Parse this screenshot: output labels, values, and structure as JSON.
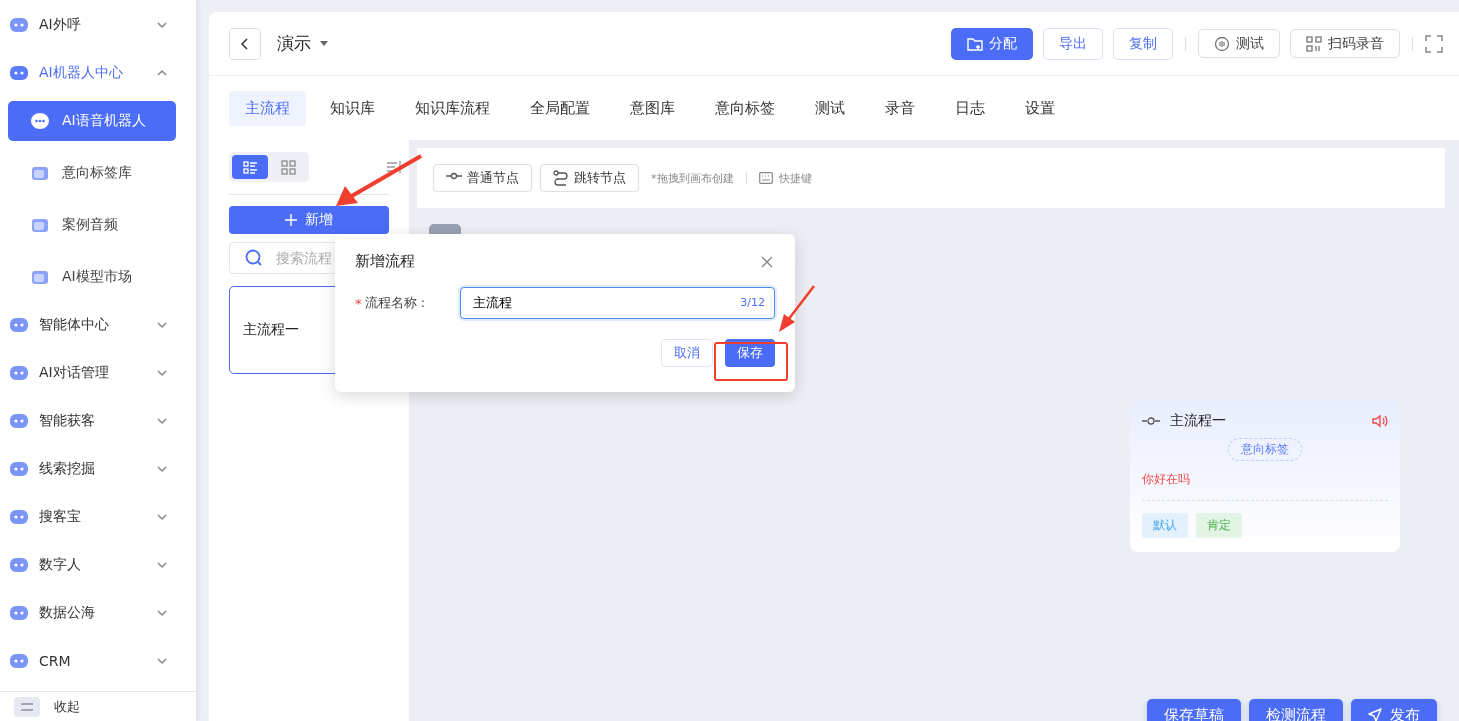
{
  "sidebar": {
    "items": [
      {
        "label": "AI外呼",
        "kind": "group",
        "expanded": false
      },
      {
        "label": "AI机器人中心",
        "kind": "group",
        "expanded": true,
        "children": [
          {
            "label": "AI语音机器人",
            "selected": true
          },
          {
            "label": "意向标签库",
            "selected": false
          },
          {
            "label": "案例音频",
            "selected": false
          },
          {
            "label": "AI模型市场",
            "selected": false
          }
        ]
      },
      {
        "label": "智能体中心",
        "kind": "group",
        "expanded": false
      },
      {
        "label": "AI对话管理",
        "kind": "group",
        "expanded": false
      },
      {
        "label": "智能获客",
        "kind": "group",
        "expanded": false
      },
      {
        "label": "线索挖掘",
        "kind": "group",
        "expanded": false
      },
      {
        "label": "搜客宝",
        "kind": "group",
        "expanded": false
      },
      {
        "label": "数字人",
        "kind": "group",
        "expanded": false
      },
      {
        "label": "数据公海",
        "kind": "group",
        "expanded": false
      },
      {
        "label": "CRM",
        "kind": "group",
        "expanded": false
      }
    ],
    "footer": "收起"
  },
  "header": {
    "title": "演示",
    "buttons": [
      {
        "label": "分配",
        "kind": "primary"
      },
      {
        "label": "导出",
        "kind": "outline"
      },
      {
        "label": "复制",
        "kind": "outline"
      },
      {
        "label": "测试",
        "kind": "plain"
      },
      {
        "label": "扫码录音",
        "kind": "plain"
      }
    ]
  },
  "tabs": [
    {
      "label": "主流程",
      "selected": true
    },
    {
      "label": "知识库",
      "selected": false
    },
    {
      "label": "知识库流程",
      "selected": false
    },
    {
      "label": "全局配置",
      "selected": false
    },
    {
      "label": "意图库",
      "selected": false
    },
    {
      "label": "意向标签",
      "selected": false
    },
    {
      "label": "测试",
      "selected": false
    },
    {
      "label": "录音",
      "selected": false
    },
    {
      "label": "日志",
      "selected": false
    },
    {
      "label": "设置",
      "selected": false
    }
  ],
  "flow_panel": {
    "views": [
      {
        "kind": "list",
        "selected": true
      },
      {
        "kind": "grid",
        "selected": false
      }
    ],
    "add_button": "新增",
    "search": {
      "placeholder": "搜索流程"
    },
    "flows": [
      {
        "label": "主流程一",
        "selected": true
      }
    ]
  },
  "toolbar": {
    "nodes": [
      {
        "label": "普通节点",
        "kind": "normal"
      },
      {
        "label": "跳转节点",
        "kind": "jump"
      }
    ],
    "hint": "*拖拽到画布创建",
    "shortcut": "快捷键"
  },
  "node": {
    "title": "主流程一",
    "tag": "意向标签",
    "speech": "你好在吗",
    "branches": [
      {
        "label": "默认",
        "kind": "default"
      },
      {
        "label": "肯定",
        "kind": "positive"
      }
    ]
  },
  "dialog": {
    "title": "新增流程",
    "field": {
      "required_mark": "*",
      "label": "流程名称 :",
      "value": "主流程",
      "counter": "3/12"
    },
    "cancel": "取消",
    "save": "保存"
  },
  "footer_buttons": [
    {
      "label": "保存草稿"
    },
    {
      "label": "检测流程"
    },
    {
      "label": "发布"
    }
  ]
}
